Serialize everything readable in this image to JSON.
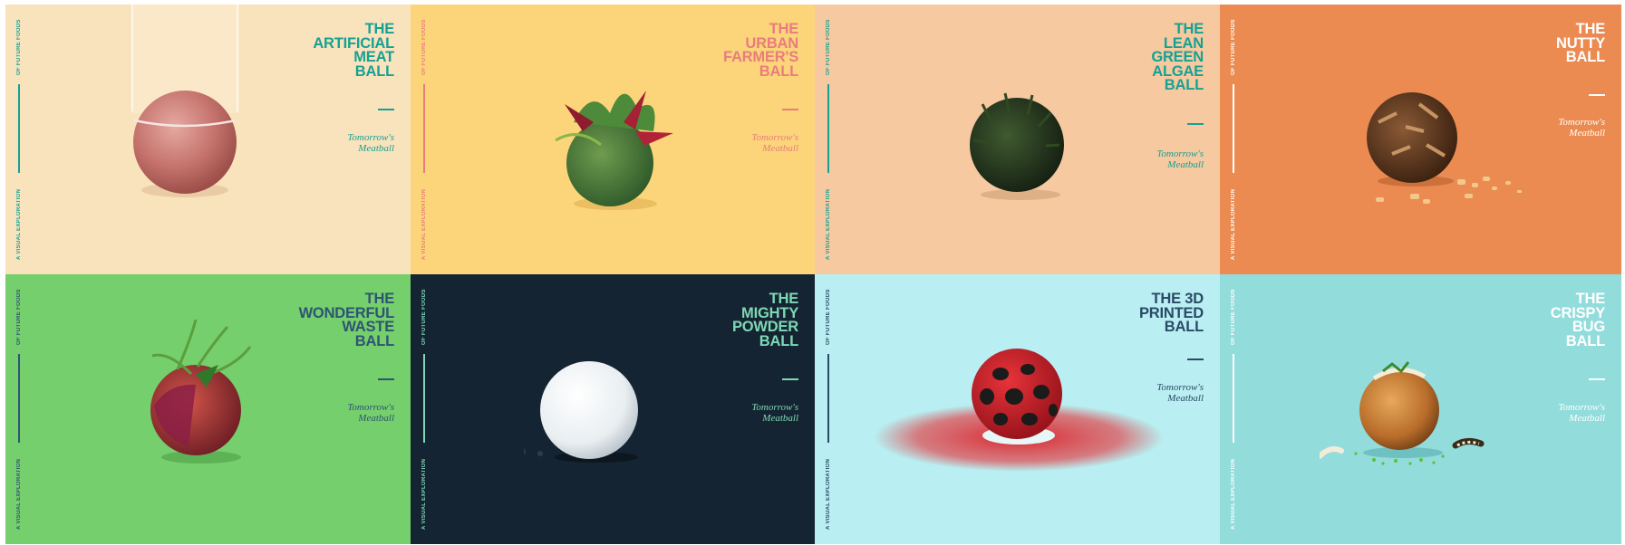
{
  "panels": [
    {
      "id": "artificial",
      "title_lines": [
        "THE",
        "ARTIFICIAL",
        "MEAT",
        "BALL"
      ],
      "tagline_lines": [
        "Tomorrow's",
        "Meatball"
      ],
      "side_top": "OF FUTURE FOODS",
      "side_bottom": "A VISUAL EXPLORATION",
      "colors": {
        "bg": "#f9e3bd",
        "title": "#16a193",
        "tag": "#16a193",
        "side": "#16a193"
      }
    },
    {
      "id": "urban",
      "title_lines": [
        "THE",
        "URBAN",
        "FARMER'S",
        "BALL"
      ],
      "tagline_lines": [
        "Tomorrow's",
        "Meatball"
      ],
      "side_top": "OF FUTURE FOODS",
      "side_bottom": "A VISUAL EXPLORATION",
      "colors": {
        "bg": "#fcd57a",
        "title": "#e97d7d",
        "tag": "#e97d7d",
        "side": "#e97d7d"
      }
    },
    {
      "id": "algae",
      "title_lines": [
        "THE",
        "LEAN",
        "GREEN",
        "ALGAE",
        "BALL"
      ],
      "tagline_lines": [
        "Tomorrow's",
        "Meatball"
      ],
      "side_top": "OF FUTURE FOODS",
      "side_bottom": "A VISUAL EXPLORATION",
      "colors": {
        "bg": "#f6c9a0",
        "title": "#16a193",
        "tag": "#16a193",
        "side": "#16a193"
      }
    },
    {
      "id": "nutty",
      "title_lines": [
        "THE",
        "NUTTY",
        "BALL"
      ],
      "tagline_lines": [
        "Tomorrow's",
        "Meatball"
      ],
      "side_top": "OF FUTURE FOODS",
      "side_bottom": "A VISUAL EXPLORATION",
      "colors": {
        "bg": "#eb8b51",
        "title": "#ffffff",
        "tag": "#ffffff",
        "side": "#ffffff"
      }
    },
    {
      "id": "waste",
      "title_lines": [
        "THE",
        "WONDERFUL",
        "WASTE",
        "BALL"
      ],
      "tagline_lines": [
        "Tomorrow's",
        "Meatball"
      ],
      "side_top": "OF FUTURE FOODS",
      "side_bottom": "A VISUAL EXPLORATION",
      "colors": {
        "bg": "#75cf6c",
        "title": "#2e5473",
        "tag": "#2e5473",
        "side": "#2e5473"
      }
    },
    {
      "id": "powder",
      "title_lines": [
        "THE",
        "MIGHTY",
        "POWDER",
        "BALL"
      ],
      "tagline_lines": [
        "Tomorrow's",
        "Meatball"
      ],
      "side_top": "OF FUTURE FOODS",
      "side_bottom": "A VISUAL EXPLORATION",
      "colors": {
        "bg": "#152432",
        "title": "#7ed8b5",
        "tag": "#7ed8b5",
        "side": "#7ed8b5"
      }
    },
    {
      "id": "printed",
      "title_lines": [
        "THE 3D",
        "PRINTED",
        "BALL"
      ],
      "tagline_lines": [
        "Tomorrow's",
        "Meatball"
      ],
      "side_top": "OF FUTURE FOODS",
      "side_bottom": "A VISUAL EXPLORATION",
      "colors": {
        "bg": "#b9eff2",
        "title": "#2a4a66",
        "tag": "#2a4a66",
        "side": "#2a4a66"
      }
    },
    {
      "id": "bug",
      "title_lines": [
        "THE",
        "CRISPY",
        "BUG",
        "BALL"
      ],
      "tagline_lines": [
        "Tomorrow's",
        "Meatball"
      ],
      "side_top": "OF FUTURE FOODS",
      "side_bottom": "A VISUAL EXPLORATION",
      "colors": {
        "bg": "#93dcdc",
        "title": "#ffffff",
        "tag": "#ffffff",
        "side": "#ffffff"
      }
    }
  ]
}
